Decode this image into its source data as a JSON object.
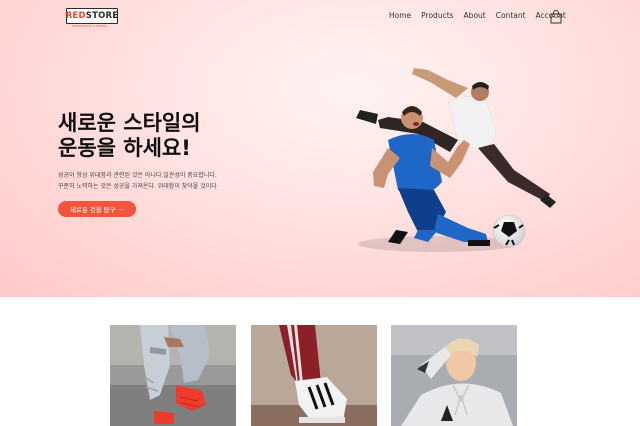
{
  "brand": {
    "logo_part1": "RED",
    "logo_part2": "STORE",
    "tagline": "SPORTSWEAR & APPAREL"
  },
  "nav": [
    {
      "label": "Home"
    },
    {
      "label": "Products"
    },
    {
      "label": "About"
    },
    {
      "label": "Contant"
    },
    {
      "label": "Account"
    }
  ],
  "cart": {
    "icon": "shopping-bag-icon"
  },
  "hero": {
    "headline_line1": "새로운 스타일의",
    "headline_line2": "운동을 하세요!",
    "sub_line1": "성공이 항상 위대함과 관련된 것은 아니다.일관성이 중요합니다.",
    "sub_line2": "꾸준히 노력하는 것은 성공을 가져온다. 위대함이 찾아올 것이다",
    "cta_label": "새로운 것을 탐구",
    "cta_arrow": "→",
    "image_icon": "soccer-players-image"
  },
  "products": [
    {
      "image": "sneakers-legs-image"
    },
    {
      "image": "striped-pants-sneakers-image"
    },
    {
      "image": "woman-hoodie-image"
    }
  ],
  "colors": {
    "accent": "#f2553e",
    "hero_bg": "#ffd6d5",
    "text": "#0f0f0f"
  }
}
